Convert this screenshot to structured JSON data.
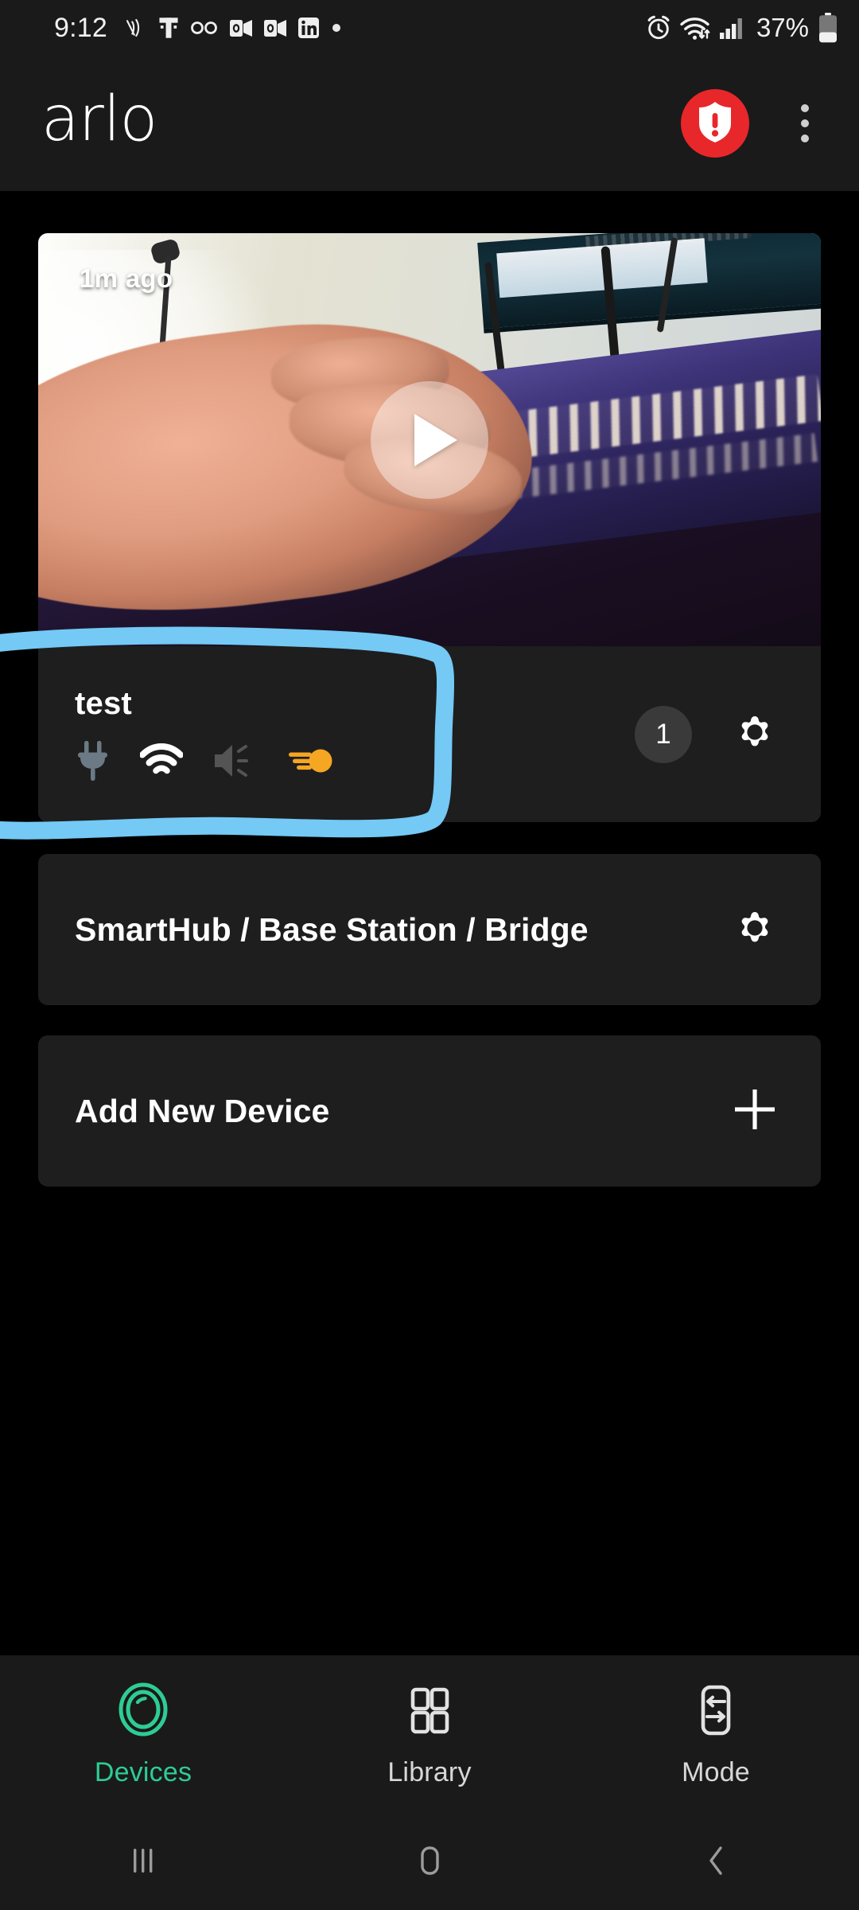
{
  "status_bar": {
    "time": "9:12",
    "battery_percent": "37%",
    "left_icons": [
      "mute-vibrate-icon",
      "t-mobile-icon",
      "voicemail-icon",
      "outlook-icon",
      "outlook-icon",
      "linkedin-icon",
      "dot-icon"
    ],
    "right_icons": [
      "alarm-icon",
      "wifi-icon",
      "cellular-signal-icon",
      "battery-icon"
    ]
  },
  "app_bar": {
    "logo_text": "arlo",
    "alert_icon": "shield-exclamation-icon",
    "alert_color": "#E8272A",
    "menu_icon": "overflow-menu-icon"
  },
  "camera_card": {
    "timestamp": "1m ago",
    "play_icon": "play-icon",
    "device_name": "test",
    "status_icons": [
      {
        "name": "power-plug-icon",
        "color": "#6b7a85",
        "state": "unplugged"
      },
      {
        "name": "wifi-icon",
        "color": "#ffffff",
        "state": "strong"
      },
      {
        "name": "speaker-mute-icon",
        "color": "#555555",
        "state": "muted"
      },
      {
        "name": "spotlight-icon",
        "color": "#f5a623",
        "state": "on"
      }
    ],
    "notification_count": "1",
    "settings_icon": "gear-icon"
  },
  "hub_row": {
    "title": "SmartHub / Base Station / Bridge",
    "settings_icon": "gear-icon"
  },
  "add_row": {
    "title": "Add New Device",
    "add_icon": "plus-icon"
  },
  "annotation": {
    "shape": "hand-drawn-rectangle",
    "color": "#74C9F5"
  },
  "bottom_nav": {
    "active": "Devices",
    "active_color": "#2ecc94",
    "items": [
      {
        "label": "Devices",
        "icon": "camera-lens-icon"
      },
      {
        "label": "Library",
        "icon": "grid-icon"
      },
      {
        "label": "Mode",
        "icon": "mode-sliders-icon"
      }
    ]
  },
  "system_nav": {
    "buttons": [
      {
        "name": "recents-button",
        "icon": "recents-icon"
      },
      {
        "name": "home-button",
        "icon": "home-icon"
      },
      {
        "name": "back-button",
        "icon": "back-chevron-icon"
      }
    ]
  }
}
